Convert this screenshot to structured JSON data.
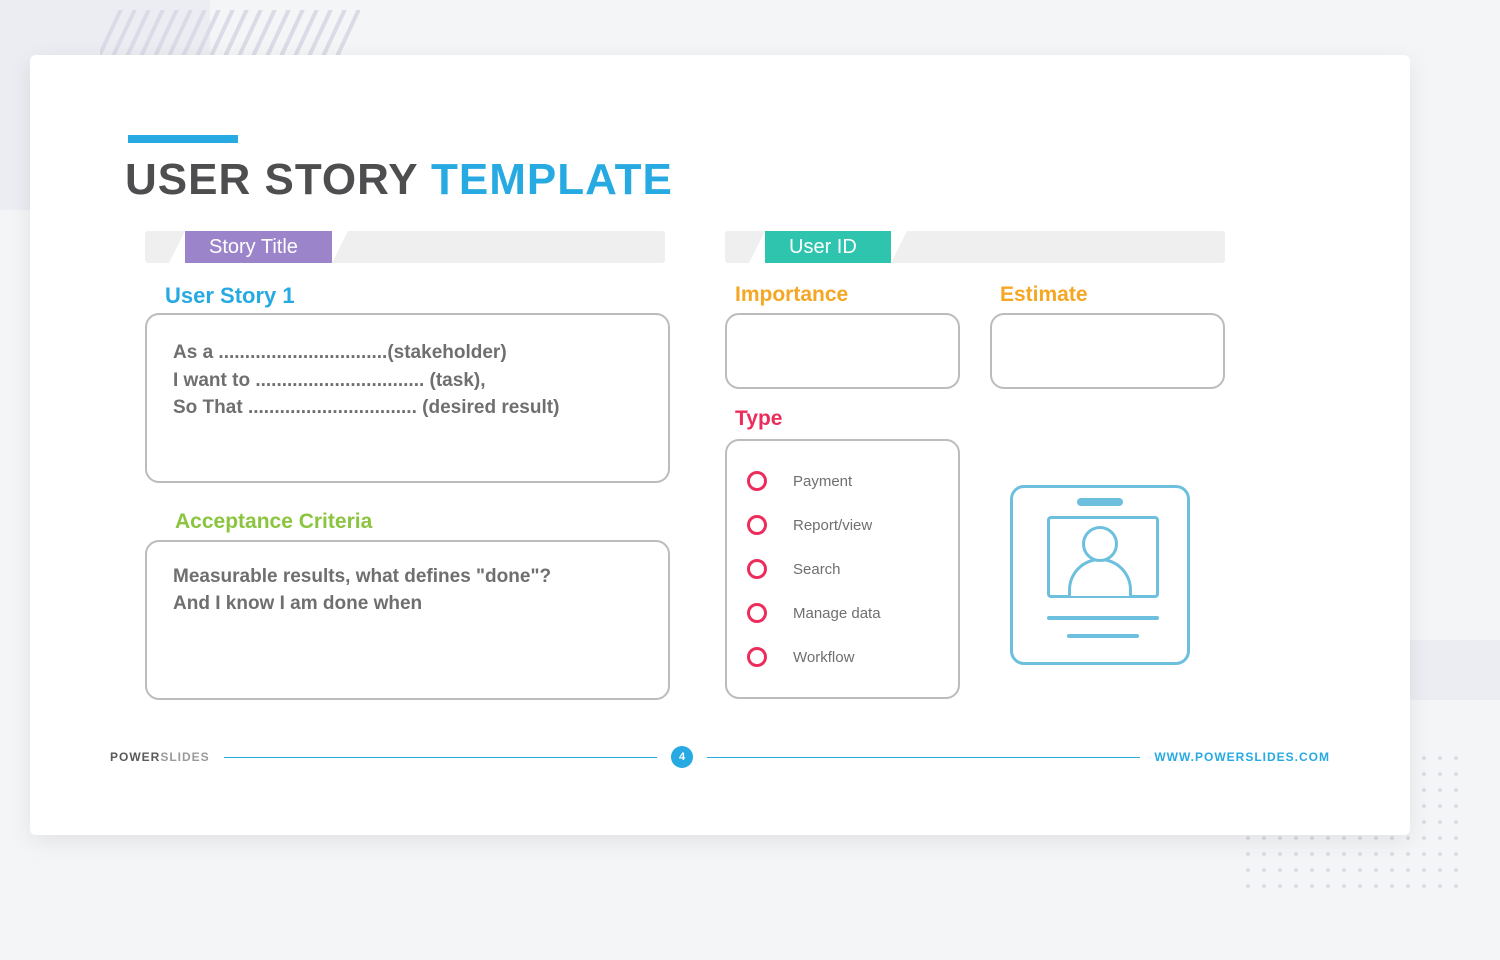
{
  "title": {
    "part1": "USER STORY ",
    "part2": "TEMPLATE"
  },
  "left_tab": "Story Title",
  "right_tab": "User ID",
  "user_story_heading": "User Story 1",
  "story_lines": {
    "l1": "As a ................................(stakeholder)",
    "l2": "I want to ................................ (task),",
    "l3": "So That ................................ (desired result)"
  },
  "acceptance_heading": "Acceptance Criteria",
  "acceptance_lines": {
    "l1": "Measurable results, what defines \"done\"?",
    "l2": "And I know I am done  when"
  },
  "labels": {
    "importance": "Importance",
    "estimate": "Estimate",
    "type": "Type"
  },
  "types": {
    "t0": "Payment",
    "t1": "Report/view",
    "t2": "Search",
    "t3": "Manage data",
    "t4": "Workflow"
  },
  "footer": {
    "brand_bold": "POWER",
    "brand_light": "SLIDES",
    "page": "4",
    "url": "WWW.POWERSLIDES.COM"
  }
}
